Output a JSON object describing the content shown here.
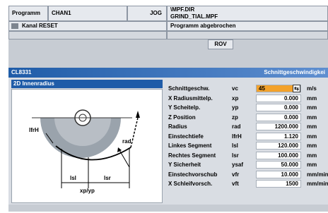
{
  "header": {
    "programm_label": "Programm",
    "channel": "CHAN1",
    "mode": "JOG",
    "path_line1": "\\MPF.DIR",
    "path_line2": "GRIND_TIAL.MPF",
    "channel_status": "Kanal RESET",
    "program_status": "Programm abgebrochen",
    "rov": "ROV"
  },
  "title_bar": {
    "left": "CL8331",
    "right": "Schnittgeschwindigkei"
  },
  "panel": {
    "subtitle": "2D Innenradius"
  },
  "graphic_labels": {
    "lfrH": "lfrH",
    "rad": "rad",
    "lsl": "lsl",
    "lsr": "lsr",
    "xpyp": "xp/yp"
  },
  "params": [
    {
      "label": "Schnittgeschw.",
      "symbol": "vc",
      "value": "45",
      "unit": "m/s",
      "active": true
    },
    {
      "label": "X Radiusmittelp.",
      "symbol": "xp",
      "value": "0.000",
      "unit": "mm"
    },
    {
      "label": "Y Scheitelp.",
      "symbol": "yp",
      "value": "0.000",
      "unit": "mm"
    },
    {
      "label": "Z Position",
      "symbol": "zp",
      "value": "0.000",
      "unit": "mm"
    },
    {
      "label": "Radius",
      "symbol": "rad",
      "value": "1200.000",
      "unit": "mm"
    },
    {
      "label": "Einstechtiefe",
      "symbol": "lfrH",
      "value": "1.120",
      "unit": "mm"
    },
    {
      "label": "Linkes Segment",
      "symbol": "lsl",
      "value": "120.000",
      "unit": "mm"
    },
    {
      "label": "Rechtes Segment",
      "symbol": "lsr",
      "value": "100.000",
      "unit": "mm"
    },
    {
      "label": "Y Sicherheit",
      "symbol": "ysaf",
      "value": "50.000",
      "unit": "mm"
    },
    {
      "label": "Einstechvorschub",
      "symbol": "vfr",
      "value": "10.000",
      "unit": "mm/min"
    },
    {
      "label": "X Schleifvorsch.",
      "symbol": "vft",
      "value": "1500",
      "unit": "mm/min"
    }
  ]
}
